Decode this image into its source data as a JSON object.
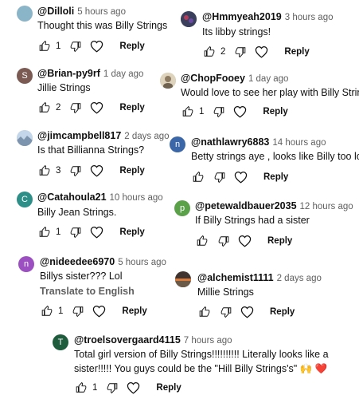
{
  "comments": [
    {
      "handle": "@Dilloli",
      "time": "5 hours ago",
      "text": [
        "Thought this was Billy Strings"
      ],
      "likes": "1",
      "reply": "Reply",
      "avatar_letter": "",
      "avatar_color": "#8ab4c8"
    },
    {
      "handle": "@Hmmyeah2019",
      "time": "3 hours ago",
      "text": [
        "Its libby strings!"
      ],
      "likes": "2",
      "reply": "Reply",
      "avatar_letter": "",
      "avatar_color": "#3a3f5c"
    },
    {
      "handle": "@Brian-py9rf",
      "time": "1 day ago",
      "text": [
        "Jillie Strings"
      ],
      "likes": "2",
      "reply": "Reply",
      "avatar_letter": "S",
      "avatar_color": "#7b5a53"
    },
    {
      "handle": "@ChopFooey",
      "time": "1 day ago",
      "text": [
        "Would love to see her play with Billy Strings."
      ],
      "likes": "1",
      "reply": "Reply",
      "avatar_letter": "",
      "avatar_color": "#c9b68f"
    },
    {
      "handle": "@jimcampbell817",
      "time": "2 days ago",
      "text": [
        "Is that Billianna Strings?"
      ],
      "likes": "3",
      "reply": "Reply",
      "avatar_letter": "",
      "avatar_color": "#a7c2dd"
    },
    {
      "handle": "@nathlawry6883",
      "time": "14 hours ago",
      "text": [
        "Betty strings aye , looks like Billy too lol"
      ],
      "likes": "",
      "reply": "Reply",
      "avatar_letter": "n",
      "avatar_color": "#3b66a8"
    },
    {
      "handle": "@Catahoula21",
      "time": "10 hours ago",
      "text": [
        "Billy Jean Strings."
      ],
      "likes": "1",
      "reply": "Reply",
      "avatar_letter": "C",
      "avatar_color": "#2e8f88"
    },
    {
      "handle": "@petewaldbauer2035",
      "time": "12 hours ago",
      "text": [
        "If Billy Strings had a sister"
      ],
      "likes": "",
      "reply": "Reply",
      "avatar_letter": "p",
      "avatar_color": "#5aa14a"
    },
    {
      "handle": "@nideedee6970",
      "time": "5 hours ago",
      "text": [
        "Billys sister??? Lol"
      ],
      "translate": "Translate to English",
      "likes": "1",
      "reply": "Reply",
      "avatar_letter": "n",
      "avatar_color": "#9c4fc1"
    },
    {
      "handle": "@alchemist1111",
      "time": "2 days ago",
      "text": [
        "Millie Strings"
      ],
      "likes": "",
      "reply": "Reply",
      "avatar_letter": "",
      "avatar_color": "#5c4a3c"
    },
    {
      "handle": "@troelsovergaard4115",
      "time": "7 hours ago",
      "text": [
        "Total girl version of Billy Strings!!!!!!!!!! Literally looks like a",
        "sister!!!!! You guys could be the \"Hill Billy Strings's\""
      ],
      "emoji": [
        "🙌",
        "❤️"
      ],
      "likes": "1",
      "reply": "Reply",
      "avatar_letter": "T",
      "avatar_color": "#1f5c3d"
    }
  ],
  "icons": {
    "like": "thumbs-up-icon",
    "dislike": "thumbs-down-icon",
    "heart": "heart-icon"
  }
}
